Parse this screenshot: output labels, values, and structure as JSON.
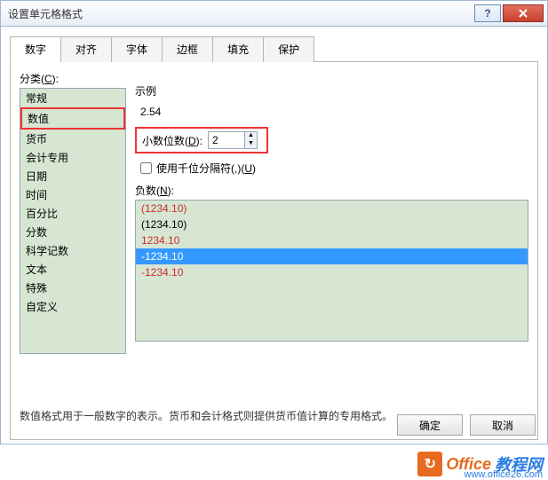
{
  "window": {
    "title": "设置单元格格式",
    "help": "?",
    "close": "X"
  },
  "tabs": [
    {
      "label": "数字",
      "active": true
    },
    {
      "label": "对齐",
      "active": false
    },
    {
      "label": "字体",
      "active": false
    },
    {
      "label": "边框",
      "active": false
    },
    {
      "label": "填充",
      "active": false
    },
    {
      "label": "保护",
      "active": false
    }
  ],
  "category": {
    "label": "分类(C):",
    "label_text": "分类(",
    "label_key": "C",
    "label_suffix": "):",
    "items": [
      "常规",
      "数值",
      "货币",
      "会计专用",
      "日期",
      "时间",
      "百分比",
      "分数",
      "科学记数",
      "文本",
      "特殊",
      "自定义"
    ],
    "selected_index": 1
  },
  "sample": {
    "label": "示例",
    "value": "2.54"
  },
  "decimals": {
    "label_text": "小数位数(",
    "label_key": "D",
    "label_suffix": "):",
    "value": "2"
  },
  "thousands": {
    "label_text": "使用千位分隔符(,)(",
    "label_key": "U",
    "label_suffix": ")",
    "checked": false
  },
  "negative": {
    "label_text": "负数(",
    "label_key": "N",
    "label_suffix": "):",
    "items": [
      {
        "text": "(1234.10)",
        "red": true
      },
      {
        "text": "(1234.10)",
        "red": false
      },
      {
        "text": "1234.10",
        "red": true
      },
      {
        "text": "-1234.10",
        "red": false,
        "selected": true
      },
      {
        "text": "-1234.10",
        "red": true
      }
    ]
  },
  "description": "数值格式用于一般数字的表示。货币和会计格式则提供货币值计算的专用格式。",
  "buttons": {
    "ok": "确定",
    "cancel": "取消"
  },
  "watermark": {
    "brand1": "Office",
    "brand2": "教程网",
    "url": "www.office26.com"
  }
}
